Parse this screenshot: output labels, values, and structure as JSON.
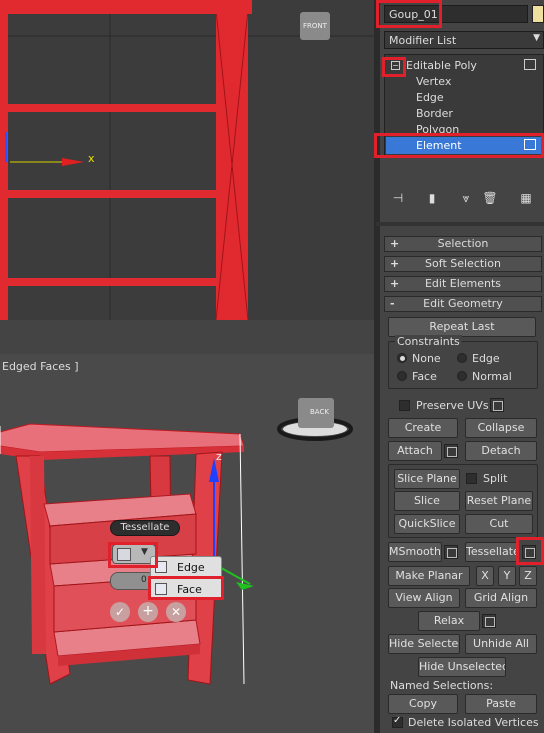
{
  "viewport_top": {
    "axis_x_label": "x",
    "viewcube_label": "FRONT"
  },
  "viewport_persp": {
    "label": "Edged Faces ]",
    "viewcube_label": "BACK",
    "axis_z_label": "z",
    "caddy": {
      "title": "Tessellate",
      "menu_items": [
        "Edge",
        "Face"
      ],
      "value": "0"
    }
  },
  "panel": {
    "object_name": "Goup_01",
    "modifier_list": "Modifier List",
    "stack": {
      "root": "Editable Poly",
      "children": [
        "Vertex",
        "Edge",
        "Border",
        "Polygon",
        "Element"
      ],
      "selected": "Element"
    },
    "rollouts": [
      {
        "sign": "+",
        "label": "Selection"
      },
      {
        "sign": "+",
        "label": "Soft Selection"
      },
      {
        "sign": "+",
        "label": "Edit Elements"
      },
      {
        "sign": "-",
        "label": "Edit Geometry"
      }
    ],
    "repeat_last": "Repeat Last",
    "constraints": {
      "title": "Constraints",
      "options": [
        "None",
        "Edge",
        "Face",
        "Normal"
      ],
      "selected": "None"
    },
    "preserve_uvs": "Preserve UVs",
    "buttons": {
      "create": "Create",
      "collapse": "Collapse",
      "attach": "Attach",
      "detach": "Detach",
      "slice_plane": "Slice Plane",
      "split": "Split",
      "slice": "Slice",
      "reset_plane": "Reset Plane",
      "quickslice": "QuickSlice",
      "cut": "Cut",
      "msmooth": "MSmooth",
      "tessellate": "Tessellate",
      "make_planar": "Make Planar",
      "x": "X",
      "y": "Y",
      "z": "Z",
      "view_align": "View Align",
      "grid_align": "Grid Align",
      "relax": "Relax",
      "hide_selected": "Hide Selected",
      "unhide_all": "Unhide All",
      "hide_unselected": "Hide Unselected",
      "named_selections": "Named Selections:",
      "copy": "Copy",
      "paste": "Paste",
      "delete_isolated": "Delete Isolated Vertices"
    }
  },
  "colors": {
    "highlight": "#e0202a",
    "mesh": "#e8343a",
    "selection": "#3a78d8"
  }
}
